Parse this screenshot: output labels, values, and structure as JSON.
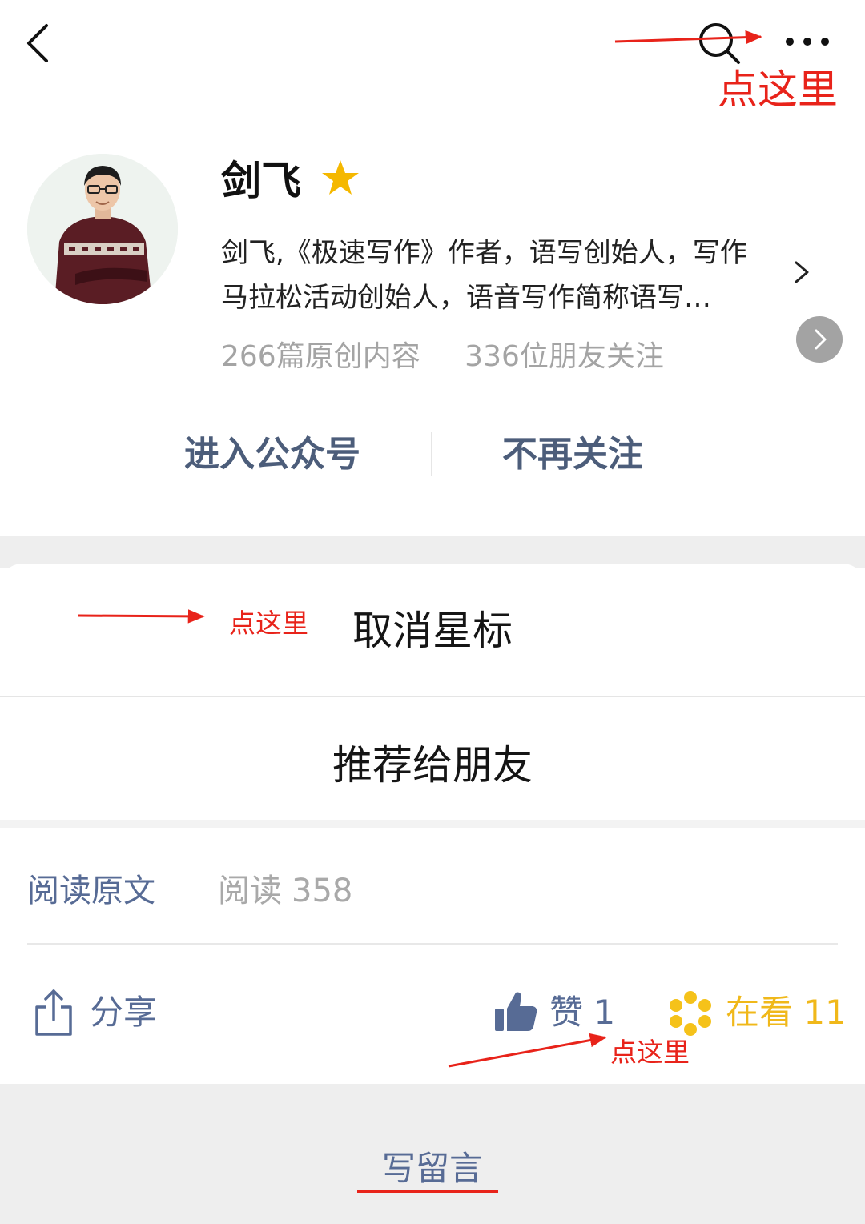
{
  "annotations": {
    "top": "点这里",
    "middle": "点这里",
    "bottom": "点这里",
    "color": "#e8231a"
  },
  "account": {
    "name": "剑飞",
    "bio_line1": "剑飞,《极速写作》作者，语写创始人，写作",
    "bio_line2": "马拉松活动创始人，语音写作简称语写…",
    "articles": "266篇原创内容",
    "followers": "336位朋友关注",
    "star_color": "#f5b800"
  },
  "actions": {
    "enter": "进入公众号",
    "unfollow": "不再关注"
  },
  "sheet": {
    "item1": "取消星标",
    "item2": "推荐给朋友"
  },
  "article": {
    "read_original": "阅读原文",
    "read_label": "阅读",
    "read_count": "358"
  },
  "footer": {
    "share": "分享",
    "like": "赞 1",
    "wow": "在看 11",
    "link_color": "#576b95",
    "wow_color": "#f0b81a"
  },
  "comment": {
    "write": "写留言"
  },
  "icons": {
    "back": "chevron-left-icon",
    "search": "search-icon",
    "more": "more-dots-icon",
    "star": "star-icon",
    "share": "share-icon",
    "like": "thumbs-up-icon",
    "wow": "wow-flower-icon"
  }
}
